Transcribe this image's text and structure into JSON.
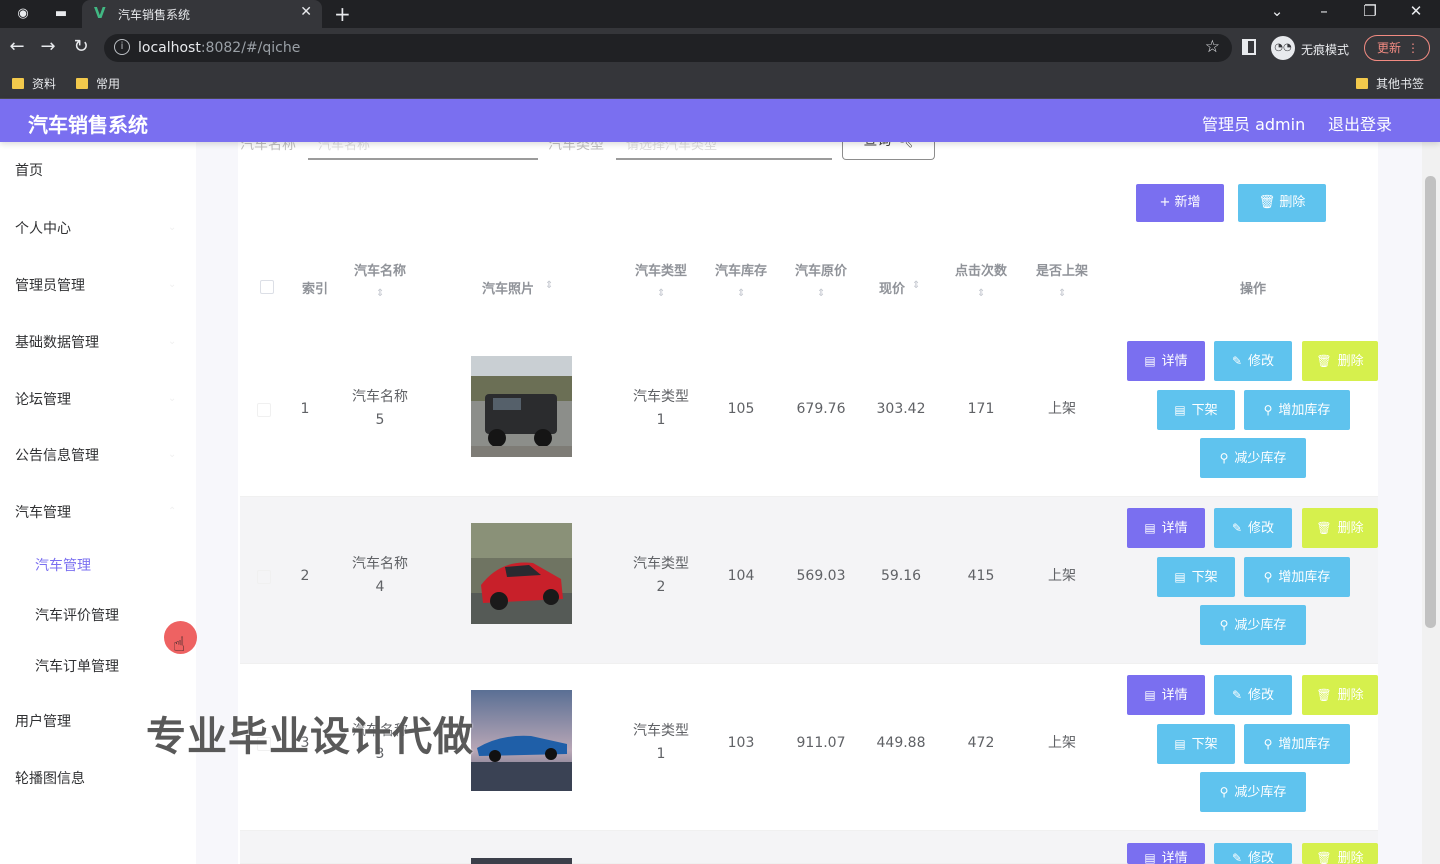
{
  "browser": {
    "tab_title": "汽车销售系统",
    "url_host": "localhost",
    "url_rest": ":8082/#/qiche",
    "incognito_label": "无痕模式",
    "update_label": "更新",
    "bookmarks": [
      "资料",
      "常用"
    ],
    "other_bookmarks": "其他书签"
  },
  "header": {
    "title": "汽车销售系统",
    "admin": "管理员 admin",
    "logout": "退出登录"
  },
  "sidebar": {
    "items": [
      "首页",
      "个人中心",
      "管理员管理",
      "基础数据管理",
      "论坛管理",
      "公告信息管理",
      "汽车管理"
    ],
    "sub_items": [
      "汽车管理",
      "汽车评价管理",
      "汽车订单管理"
    ],
    "items_after": [
      "用户管理",
      "轮播图信息"
    ]
  },
  "search": {
    "name_label": "汽车名称",
    "name_placeholder": "汽车名称",
    "type_label": "汽车类型",
    "type_placeholder": "请选择汽车类型",
    "query_label": "查询"
  },
  "toolbar": {
    "add_label": "新增",
    "delete_label": "删除"
  },
  "table": {
    "headers": {
      "index": "索引",
      "name": "汽车名称",
      "photo": "汽车照片",
      "type": "汽车类型",
      "stock": "汽车库存",
      "original_price": "汽车原价",
      "price": "现价",
      "clicks": "点击次数",
      "on_shelf": "是否上架",
      "actions": "操作"
    },
    "rows": [
      {
        "index": "1",
        "name_a": "汽车名称",
        "name_b": "5",
        "type_a": "汽车类型",
        "type_b": "1",
        "stock": "105",
        "original_price": "679.76",
        "price": "303.42",
        "clicks": "171",
        "on_shelf": "上架"
      },
      {
        "index": "2",
        "name_a": "汽车名称",
        "name_b": "4",
        "type_a": "汽车类型",
        "type_b": "2",
        "stock": "104",
        "original_price": "569.03",
        "price": "59.16",
        "clicks": "415",
        "on_shelf": "上架"
      },
      {
        "index": "3",
        "name_a": "汽车名称",
        "name_b": "3",
        "type_a": "汽车类型",
        "type_b": "1",
        "stock": "103",
        "original_price": "911.07",
        "price": "449.88",
        "clicks": "472",
        "on_shelf": "上架"
      }
    ],
    "actions": {
      "detail": "详情",
      "edit": "修改",
      "delete": "删除",
      "off_shelf": "下架",
      "add_stock": "增加库存",
      "reduce_stock": "减少库存"
    }
  },
  "watermark": "专业毕业设计代做",
  "colors": {
    "primary": "#7a6ff0",
    "cyan": "#5fc3ee",
    "lime": "#d6f04d"
  }
}
